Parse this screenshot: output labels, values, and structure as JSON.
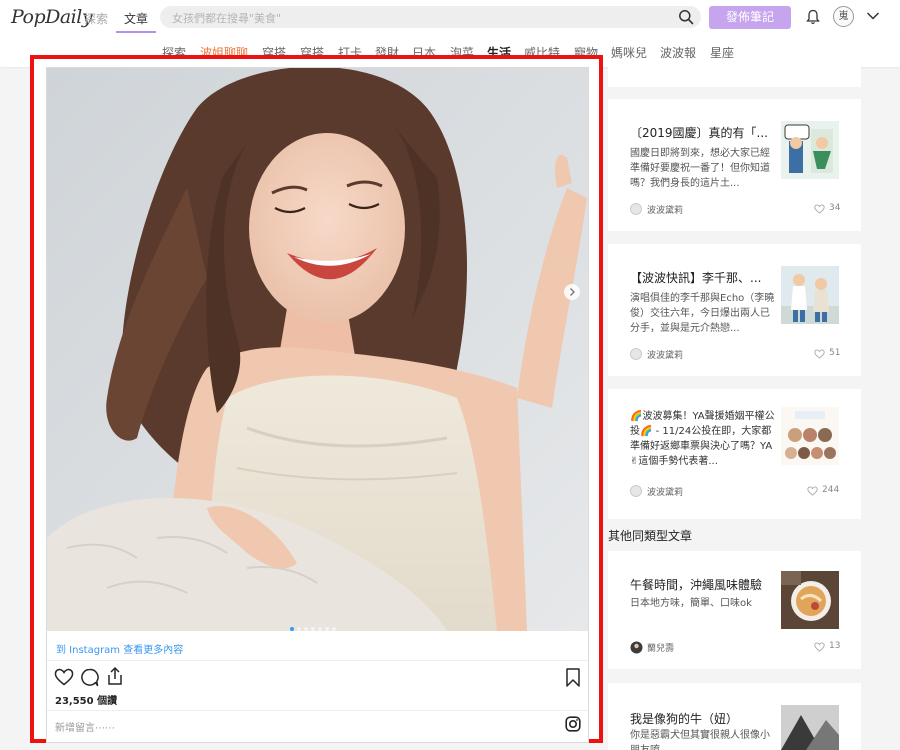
{
  "header": {
    "logo": "PopDaily",
    "nav_explore": "探索",
    "nav_article": "文章",
    "search_placeholder": "女孩們都在搜尋\"美食\"",
    "publish_button": "發佈筆記",
    "avatar_glyph": "嵬"
  },
  "categories": [
    {
      "label": "探索"
    },
    {
      "label": "波姐聊聊"
    },
    {
      "label": "穿搭"
    },
    {
      "label": "穿搭"
    },
    {
      "label": "打卡"
    },
    {
      "label": "發財"
    },
    {
      "label": "日本"
    },
    {
      "label": "泡菜"
    },
    {
      "label": "生活"
    },
    {
      "label": "威比特"
    },
    {
      "label": "寵物"
    },
    {
      "label": "媽咪兒"
    },
    {
      "label": "波波報"
    },
    {
      "label": "星座"
    }
  ],
  "instagram": {
    "view_more_link": "到 Instagram 查看更多內容",
    "likes": "23,550 個讚",
    "comment_placeholder": "新增留言⋯⋯",
    "slide_count": 7,
    "current_slide": 1
  },
  "sidebar": {
    "cards": [
      {
        "title": "〔2019國慶〕真的有「...",
        "desc": "國慶日即將到來，想必大家已經準備好要慶祝一番了！但你知道嗎？我們身長的這片土...",
        "author": "波波黛莉",
        "likes": "34"
      },
      {
        "title": "【波波快訊】李千那、...",
        "desc": "演唱俱佳的李千那與Echo（李曉俊）交往六年，今日爆出兩人已分手，並與是元介熱戀...",
        "author": "波波黛莉",
        "likes": "51"
      },
      {
        "title": "🌈波波募集！YA聲援婚姻平權公投🌈 - 11/24公投在即，大家都準備好返鄉車票與決心了嗎？YA✌這個手勢代表著...",
        "author": "波波黛莉",
        "likes": "244"
      }
    ],
    "section_title": "其他同類型文章",
    "related": [
      {
        "title": "午餐時間，沖繩風味體驗",
        "desc": "日本地方味，簡單、口味ok",
        "author": "蘭兒壽",
        "likes": "13"
      },
      {
        "title": "我是像狗的牛（妞）",
        "desc": "你是惡霸犬但其實很親人很像小朋友唷"
      }
    ]
  },
  "colors": {
    "accent_purple": "#c7a4ee",
    "highlight_red": "#ee1111",
    "instagram_blue": "#3897f0"
  }
}
